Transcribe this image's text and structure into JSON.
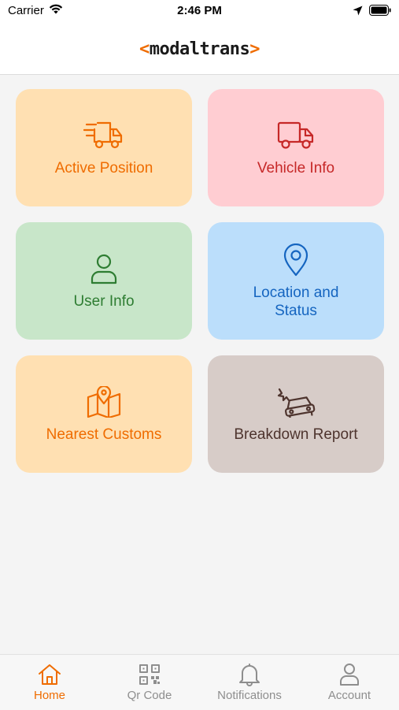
{
  "status_bar": {
    "carrier": "Carrier",
    "time": "2:46 PM"
  },
  "header": {
    "logo_left": "<",
    "logo_word": "modaltrans",
    "logo_right": ">"
  },
  "cards": [
    {
      "label": "Active Position",
      "icon": "fast-truck-icon",
      "bg": "#ffe0b2",
      "color": "#ef6c00"
    },
    {
      "label": "Vehicle Info",
      "icon": "truck-icon",
      "bg": "#ffcdd2",
      "color": "#c62828"
    },
    {
      "label": "User Info",
      "icon": "user-icon",
      "bg": "#c8e6c9",
      "color": "#2e7d32"
    },
    {
      "label": "Location and Status",
      "icon": "location-pin-icon",
      "bg": "#bbdefb",
      "color": "#1565c0"
    },
    {
      "label": "Nearest Customs",
      "icon": "map-icon",
      "bg": "#ffe0b2",
      "color": "#ef6c00"
    },
    {
      "label": "Breakdown Report",
      "icon": "car-crash-icon",
      "bg": "#d7ccc8",
      "color": "#4e342e"
    }
  ],
  "nav": {
    "active_color": "#ef6c00",
    "inactive_color": "#8e8e8e",
    "items": [
      {
        "label": "Home",
        "icon": "home-icon",
        "active": true
      },
      {
        "label": "Qr Code",
        "icon": "qr-code-icon",
        "active": false
      },
      {
        "label": "Notifications",
        "icon": "bell-icon",
        "active": false
      },
      {
        "label": "Account",
        "icon": "account-icon",
        "active": false
      }
    ]
  }
}
